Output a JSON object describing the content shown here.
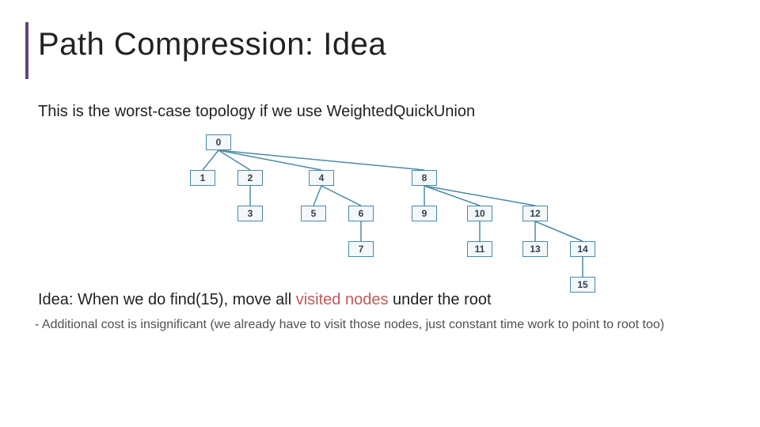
{
  "title": "Path Compression: Idea",
  "subtitle": "This is the worst-case topology if we use WeightedQuickUnion",
  "idea_prefix": "Idea: When we do find(15), move all ",
  "idea_visited": "visited nodes",
  "idea_suffix": " under the root",
  "bullet": "Additional cost is insignificant (we already have to visit those nodes, just constant time work to point to root too)",
  "chart_data": {
    "type": "tree",
    "description": "Worst-case topology tree for WeightedQuickUnion; nodes 0–15 with hierarchical parent links",
    "root": 0,
    "edges": [
      [
        0,
        1
      ],
      [
        0,
        2
      ],
      [
        0,
        4
      ],
      [
        0,
        8
      ],
      [
        2,
        3
      ],
      [
        4,
        5
      ],
      [
        4,
        6
      ],
      [
        6,
        7
      ],
      [
        8,
        9
      ],
      [
        8,
        10
      ],
      [
        8,
        12
      ],
      [
        10,
        11
      ],
      [
        12,
        13
      ],
      [
        12,
        14
      ],
      [
        14,
        15
      ]
    ],
    "levels": {
      "0": [
        0
      ],
      "1": [
        1,
        2,
        4,
        8
      ],
      "2": [
        3,
        5,
        6,
        9,
        10,
        12
      ],
      "3": [
        7,
        11,
        13,
        14
      ],
      "4": [
        15
      ]
    }
  },
  "nodes": {
    "n0": "0",
    "n1": "1",
    "n2": "2",
    "n3": "3",
    "n4": "4",
    "n5": "5",
    "n6": "6",
    "n7": "7",
    "n8": "8",
    "n9": "9",
    "n10": "10",
    "n11": "11",
    "n12": "12",
    "n13": "13",
    "n14": "14",
    "n15": "15"
  }
}
